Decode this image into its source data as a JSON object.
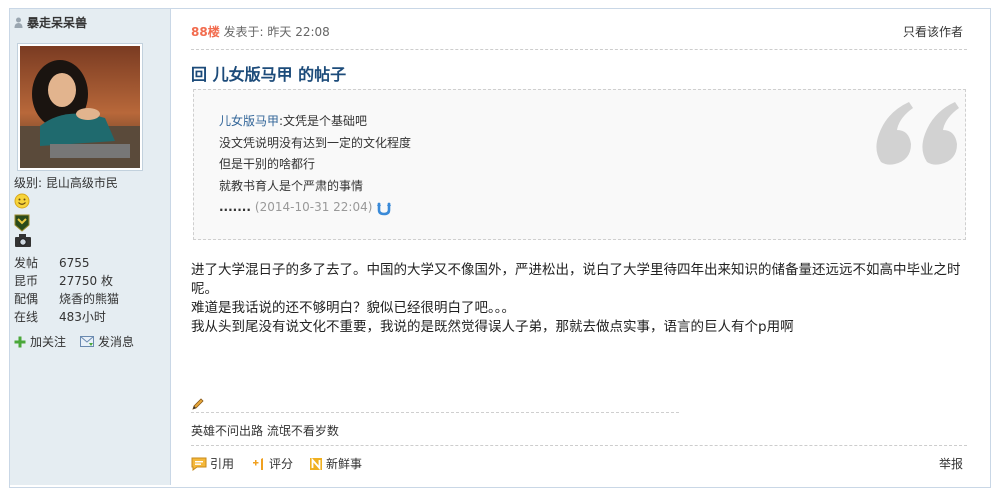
{
  "user": {
    "name": "暴走呆呆兽",
    "level": "级别: 昆山高级市民",
    "stats": [
      {
        "key": "发帖",
        "value": "6755"
      },
      {
        "key": "昆币",
        "value": "27750 枚"
      },
      {
        "key": "配偶",
        "value": "烧香的熊猫"
      },
      {
        "key": "在线",
        "value": "483小时"
      }
    ],
    "actions": {
      "follow": "加关注",
      "message": "发消息"
    }
  },
  "post": {
    "floor": "88楼",
    "posted_at": "发表于: 昨天 22:08",
    "only_author": "只看该作者",
    "title": "回 儿女版马甲 的帖子",
    "quote": {
      "author": "儿女版马甲",
      "first_line": ":文凭是个基础吧",
      "lines": [
        "没文凭说明没有达到一定的文化程度",
        "但是干别的啥都行",
        "就教书育人是个严肃的事情"
      ],
      "ellipsis": ".......",
      "date": "(2014-10-31 22:04)"
    },
    "body": [
      "进了大学混日子的多了去了。中国的大学又不像国外，严进松出，说白了大学里待四年出来知识的储备量还远远不如高中毕业之时呢。",
      "难道是我话说的还不够明白？貌似已经很明白了吧。。。",
      "我从头到尾没有说文化不重要，我说的是既然觉得误人子弟，那就去做点实事，语言的巨人有个p用啊"
    ],
    "signature": "英雄不问出路 流氓不看岁数",
    "footer": {
      "quote": "引用",
      "rate": "评分",
      "news": "新鲜事",
      "report": "举报"
    }
  },
  "colors": {
    "floor": "#f26c4f",
    "title": "#1c4b7a",
    "sidebar": "#e5edf2",
    "quote_author": "#336699"
  }
}
